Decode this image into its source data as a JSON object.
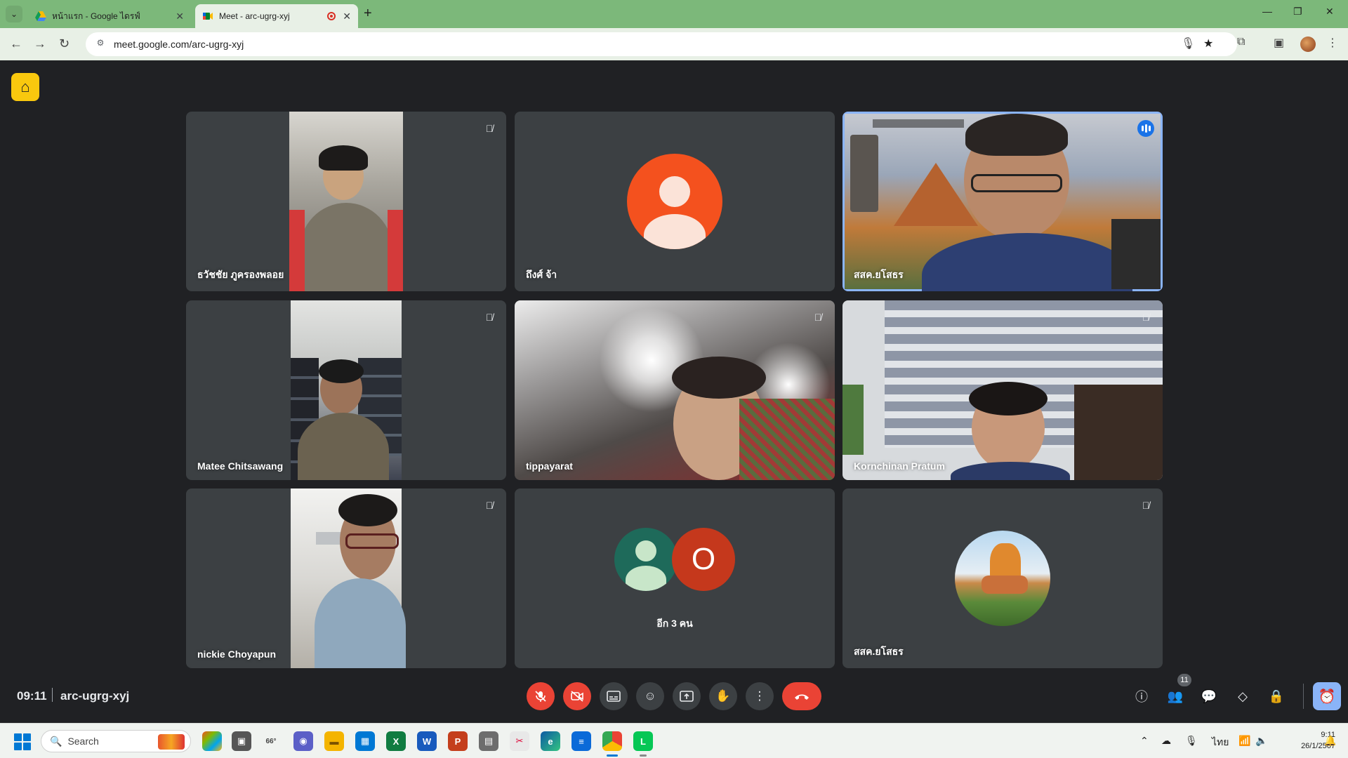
{
  "browser": {
    "tabs": [
      {
        "title": "หน้าแรก - Google ไดรฟ์",
        "active": false
      },
      {
        "title": "Meet - arc-ugrg-xyj",
        "active": true
      }
    ],
    "new_tab_label": "+",
    "url": "meet.google.com/arc-ugrg-xyj",
    "window_controls": {
      "minimize": "—",
      "restore": "❐",
      "close": "✕"
    }
  },
  "meet": {
    "tiles": [
      {
        "name": "ธวัชชัย ภูครองพลอย",
        "muted": true,
        "type": "video"
      },
      {
        "name": "ถึงศ์ จ้า",
        "muted": false,
        "type": "avatar",
        "avatar_color": "#f4511e"
      },
      {
        "name": "สสค.ยโสธร",
        "muted": false,
        "type": "video",
        "speaking": true
      },
      {
        "name": "Matee Chitsawang",
        "muted": true,
        "type": "video"
      },
      {
        "name": "tippayarat",
        "muted": true,
        "type": "video"
      },
      {
        "name": "Kornchinan Pratum",
        "muted": true,
        "type": "video"
      },
      {
        "name": "nickie Choyapun",
        "muted": true,
        "type": "video"
      },
      {
        "name": "อีก 3 คน",
        "type": "group",
        "group_initial": "O",
        "group_colors": [
          "#1e6a5a",
          "#c5381c"
        ]
      },
      {
        "name": "สสค.ยโสธร",
        "muted": true,
        "type": "avatar-photo"
      }
    ],
    "bottom": {
      "time": "09:11",
      "code": "arc-ugrg-xyj",
      "people_count": "11"
    }
  },
  "taskbar": {
    "search_label": "Search",
    "weather": "66°",
    "language": "ไทย",
    "time": "9:11",
    "date": "26/1/2567"
  },
  "colors": {
    "accent": "#1a73e8",
    "end_call": "#ea4335",
    "tile_bg": "#3c4043",
    "chrome_bar": "#7cb87a"
  }
}
